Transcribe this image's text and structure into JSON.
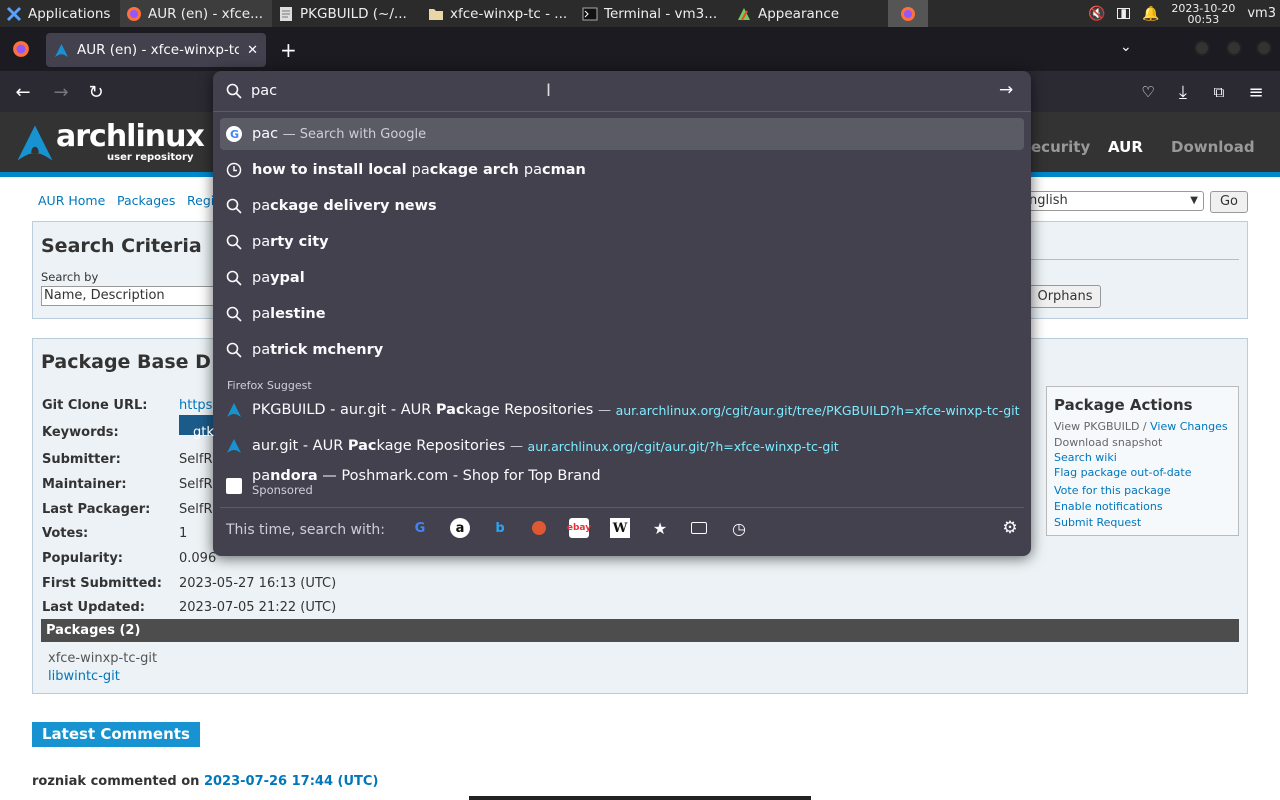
{
  "taskbar": {
    "apps_label": "Applications",
    "windows": [
      {
        "title": "AUR (en) - xfce..."
      },
      {
        "title": "PKGBUILD (~/..."
      },
      {
        "title": "xfce-winxp-tc - ..."
      },
      {
        "title": "Terminal - vm3..."
      },
      {
        "title": "Appearance"
      }
    ],
    "date": "2023-10-20",
    "time": "00:53",
    "user": "vm3"
  },
  "browser": {
    "tab_title": "AUR (en) - xfce-winxp-tc",
    "url_value": "pac"
  },
  "page": {
    "header_links": [
      "ecurity",
      "AUR",
      "Download"
    ],
    "logo_text": "archlinux",
    "logo_sub": "user repository",
    "subnav": [
      "AUR Home",
      "Packages",
      "Regi"
    ],
    "language": "nglish",
    "go_label": "Go",
    "search_criteria_title": "Search Criteria",
    "search_by_label": "Search by",
    "search_by_value": "Name, Description",
    "orphans_label": "Orphans",
    "pkgbase_title": "Package Base D",
    "details": [
      {
        "label": "Git Clone URL:",
        "value": "https"
      },
      {
        "label": "Keywords:",
        "value": "gtk"
      },
      {
        "label": "Submitter:",
        "value": "SelfR"
      },
      {
        "label": "Maintainer:",
        "value": "SelfR"
      },
      {
        "label": "Last Packager:",
        "value": "SelfR"
      },
      {
        "label": "Votes:",
        "value": "1"
      },
      {
        "label": "Popularity:",
        "value": "0.096"
      },
      {
        "label": "First Submitted:",
        "value": "2023-05-27 16:13 (UTC)"
      },
      {
        "label": "Last Updated:",
        "value": "2023-07-05 21:22 (UTC)"
      }
    ],
    "actions_title": "Package Actions",
    "actions": {
      "view_pkgbuild": "View PKGBUILD",
      "sep": "/",
      "view_changes": "View Changes",
      "download_snapshot": "Download snapshot",
      "search_wiki": "Search wiki",
      "flag": "Flag package out-of-date",
      "vote": "Vote for this package",
      "notify": "Enable notifications",
      "submit": "Submit Request"
    },
    "packages_title": "Packages (2)",
    "packages": [
      "xfce-winxp-tc-git",
      "libwintc-git"
    ],
    "latest_comments": "Latest Comments",
    "comment_author": "rozniak commented on",
    "comment_date": "2023-07-26 17:44 (UTC)"
  },
  "dropdown": {
    "top": {
      "text": "pac",
      "suffix": "— Search with Google"
    },
    "history": {
      "pre": "how to install local ",
      "a": "pa",
      "b": "ckage arch ",
      "c": "pa",
      "d": "cman"
    },
    "suggestions": [
      {
        "pre": "pa",
        "post": "ckage delivery news"
      },
      {
        "pre": "pa",
        "post": "rty city"
      },
      {
        "pre": "pa",
        "post": "ypal"
      },
      {
        "pre": "pa",
        "post": "lestine"
      },
      {
        "pre": "pa",
        "post": "trick mchenry"
      }
    ],
    "section_label": "Firefox Suggest",
    "firefox_suggest": [
      {
        "pre": "PKGBUILD - aur.git - AUR ",
        "bold": "Pac",
        "post": "kage Repositories",
        "dash": "—",
        "url": "aur.archlinux.org/cgit/aur.git/tree/PKGBUILD?h=xfce-winxp-tc-git"
      },
      {
        "pre": "aur.git - AUR ",
        "bold": "Pac",
        "post": "kage Repositories",
        "dash": "—",
        "url": "aur.archlinux.org/cgit/aur.git/?h=xfce-winxp-tc-git"
      }
    ],
    "sponsored": {
      "pre": "pa",
      "bold": "ndora",
      "post": " — Poshmark.com - Shop for Top Brand",
      "label": "Sponsored"
    },
    "search_with_label": "This time, search with:"
  },
  "colors": {
    "taskbar_bg": "#2b2b2b",
    "tabstrip_bg": "#1c1b22",
    "panel_bg": "#42414d",
    "arch_header": "#333333",
    "arch_blue": "#0088cc",
    "url_color": "#80ebff"
  }
}
